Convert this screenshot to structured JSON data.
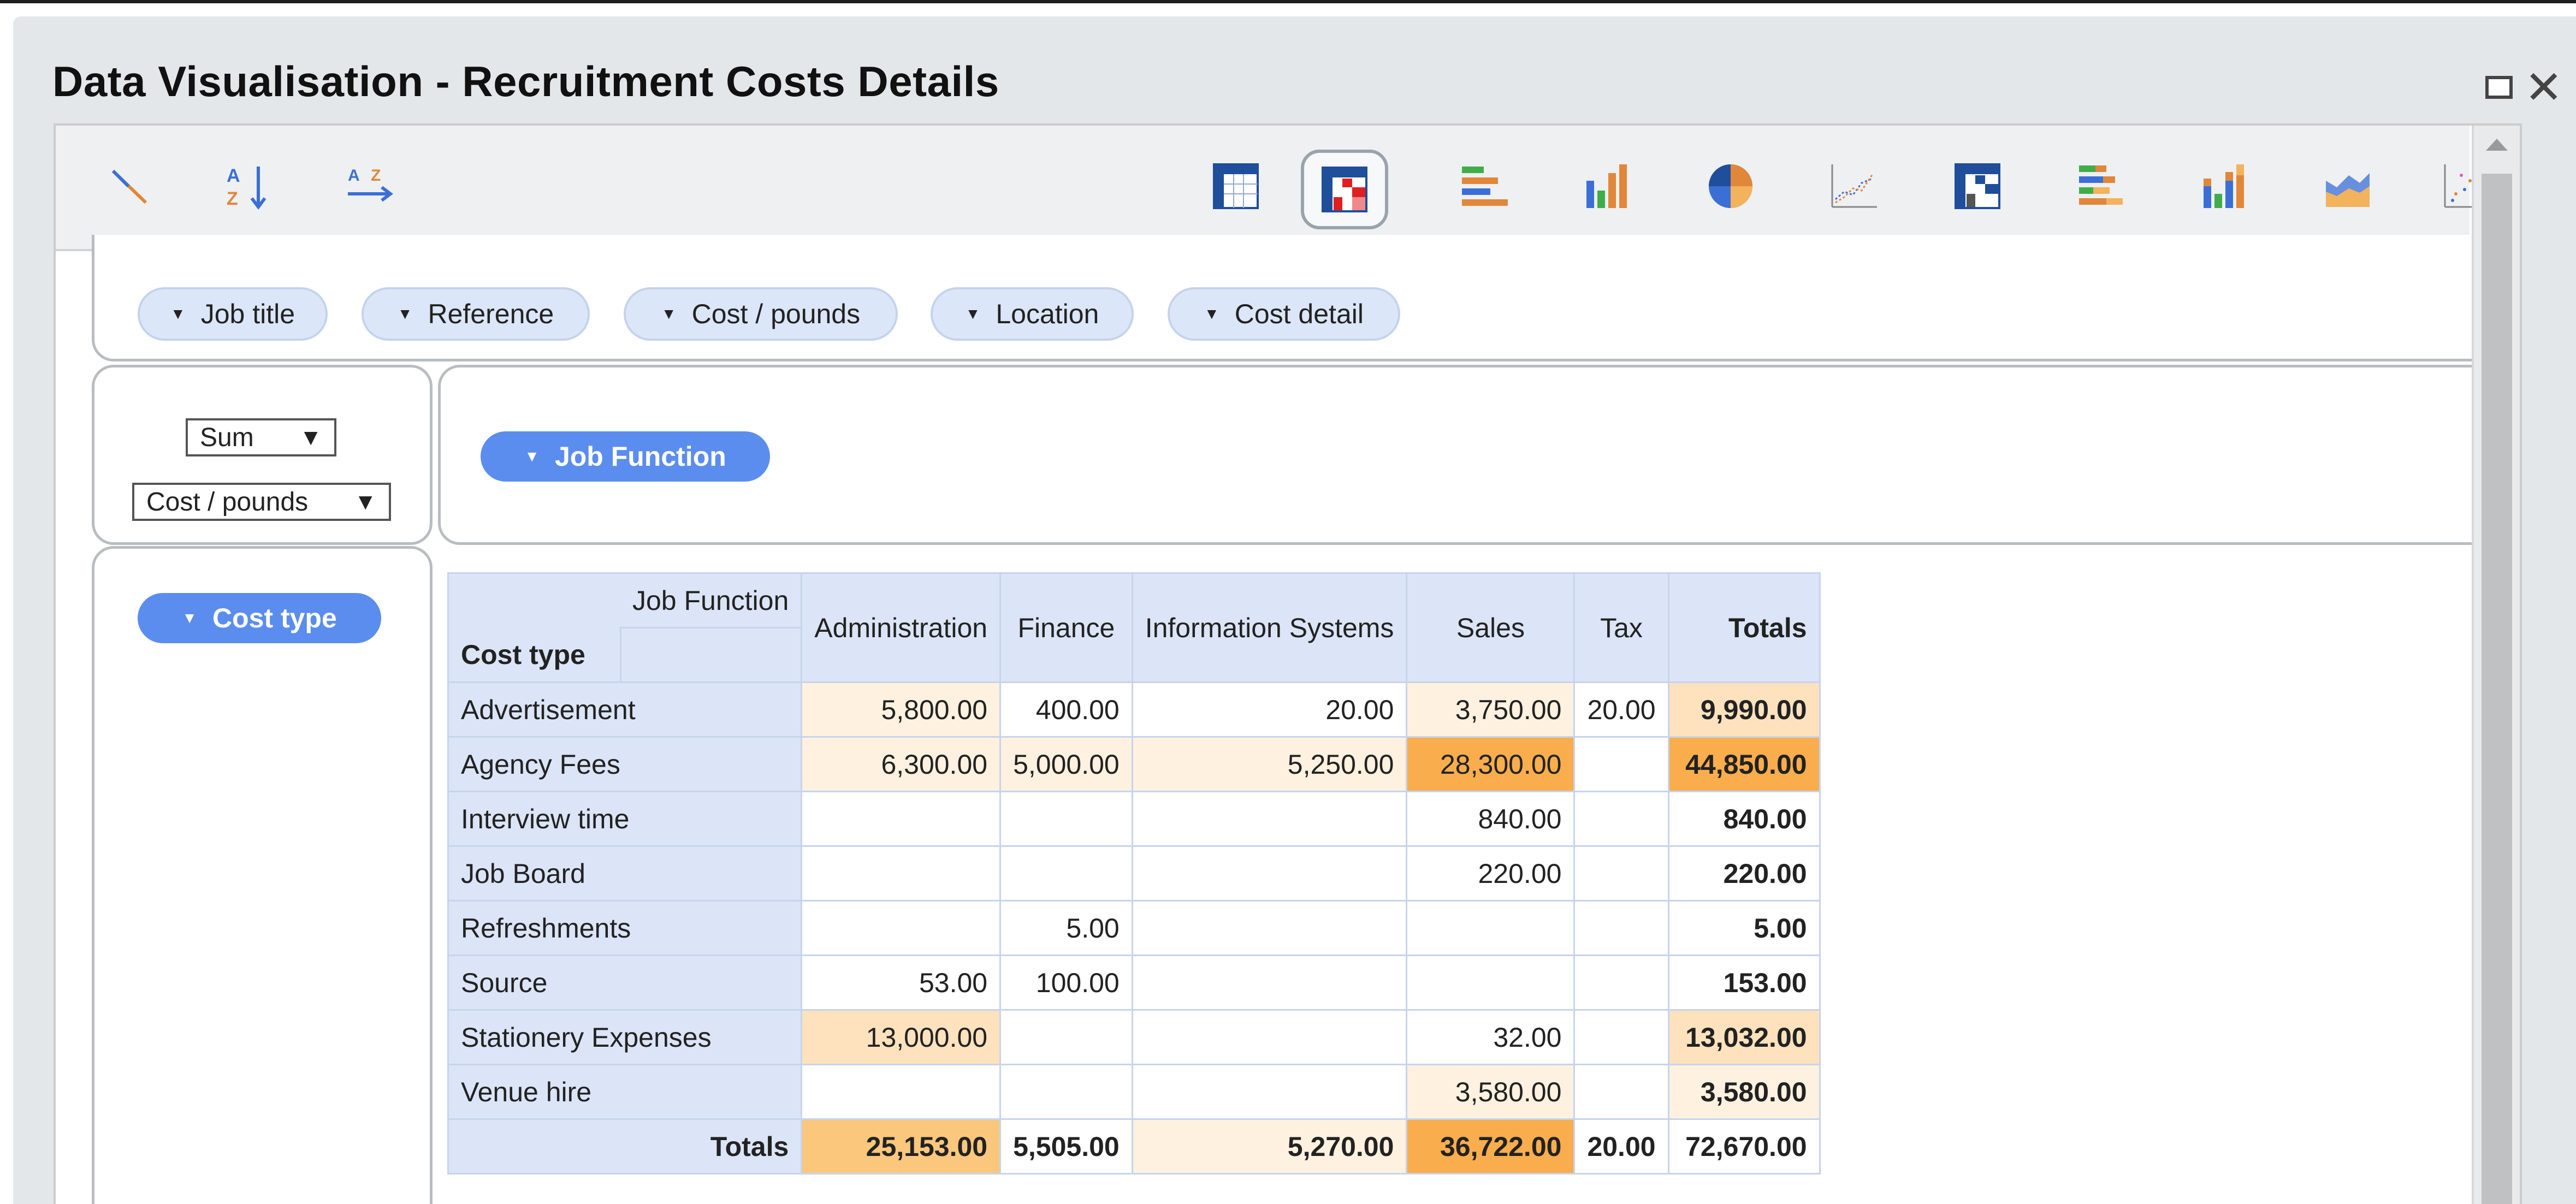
{
  "window": {
    "title": "Data Visualisation - Recruitment Costs Details",
    "controls": [
      "maximize-icon",
      "close-icon"
    ]
  },
  "toolbar": {
    "left_tools": [
      "clear-icon",
      "sort-ascending-icon",
      "sort-descending-icon"
    ],
    "chart_tools": [
      "table-grid-icon",
      "heatmap-icon",
      "horizontal-bar-icon",
      "vertical-bar-icon",
      "pie-chart-icon",
      "line-chart-icon",
      "heat-grid-icon",
      "stacked-horizontal-bar-icon",
      "stacked-vertical-bar-icon",
      "area-chart-icon",
      "scatter-chart-icon"
    ],
    "active_tool": "heatmap-icon"
  },
  "filters": [
    {
      "label": "Job title"
    },
    {
      "label": "Reference"
    },
    {
      "label": "Cost / pounds"
    },
    {
      "label": "Location"
    },
    {
      "label": "Cost detail"
    }
  ],
  "aggregation": {
    "function": "Sum",
    "field": "Cost / pounds"
  },
  "column_field": "Job Function",
  "row_field": "Cost type",
  "pivot": {
    "corner_col_label": "Job Function",
    "corner_row_label": "Cost type",
    "columns": [
      "Administration",
      "Finance",
      "Information Systems",
      "Sales",
      "Tax",
      "Totals"
    ],
    "rows": [
      {
        "label": "Advertisement",
        "values": [
          "5,800.00",
          "400.00",
          "20.00",
          "3,750.00",
          "20.00",
          "9,990.00"
        ]
      },
      {
        "label": "Agency Fees",
        "values": [
          "6,300.00",
          "5,000.00",
          "5,250.00",
          "28,300.00",
          "",
          "44,850.00"
        ]
      },
      {
        "label": "Interview time",
        "values": [
          "",
          "",
          "",
          "840.00",
          "",
          "840.00"
        ]
      },
      {
        "label": "Job Board",
        "values": [
          "",
          "",
          "",
          "220.00",
          "",
          "220.00"
        ]
      },
      {
        "label": "Refreshments",
        "values": [
          "",
          "5.00",
          "",
          "",
          "",
          "5.00"
        ]
      },
      {
        "label": "Source",
        "values": [
          "53.00",
          "100.00",
          "",
          "",
          "",
          "153.00"
        ]
      },
      {
        "label": "Stationery Expenses",
        "values": [
          "13,000.00",
          "",
          "",
          "32.00",
          "",
          "13,032.00"
        ]
      },
      {
        "label": "Venue hire",
        "values": [
          "",
          "",
          "",
          "3,580.00",
          "",
          "3,580.00"
        ]
      }
    ],
    "totals": {
      "label": "Totals",
      "values": [
        "25,153.00",
        "5,505.00",
        "5,270.00",
        "36,722.00",
        "20.00",
        "72,670.00"
      ]
    }
  }
}
